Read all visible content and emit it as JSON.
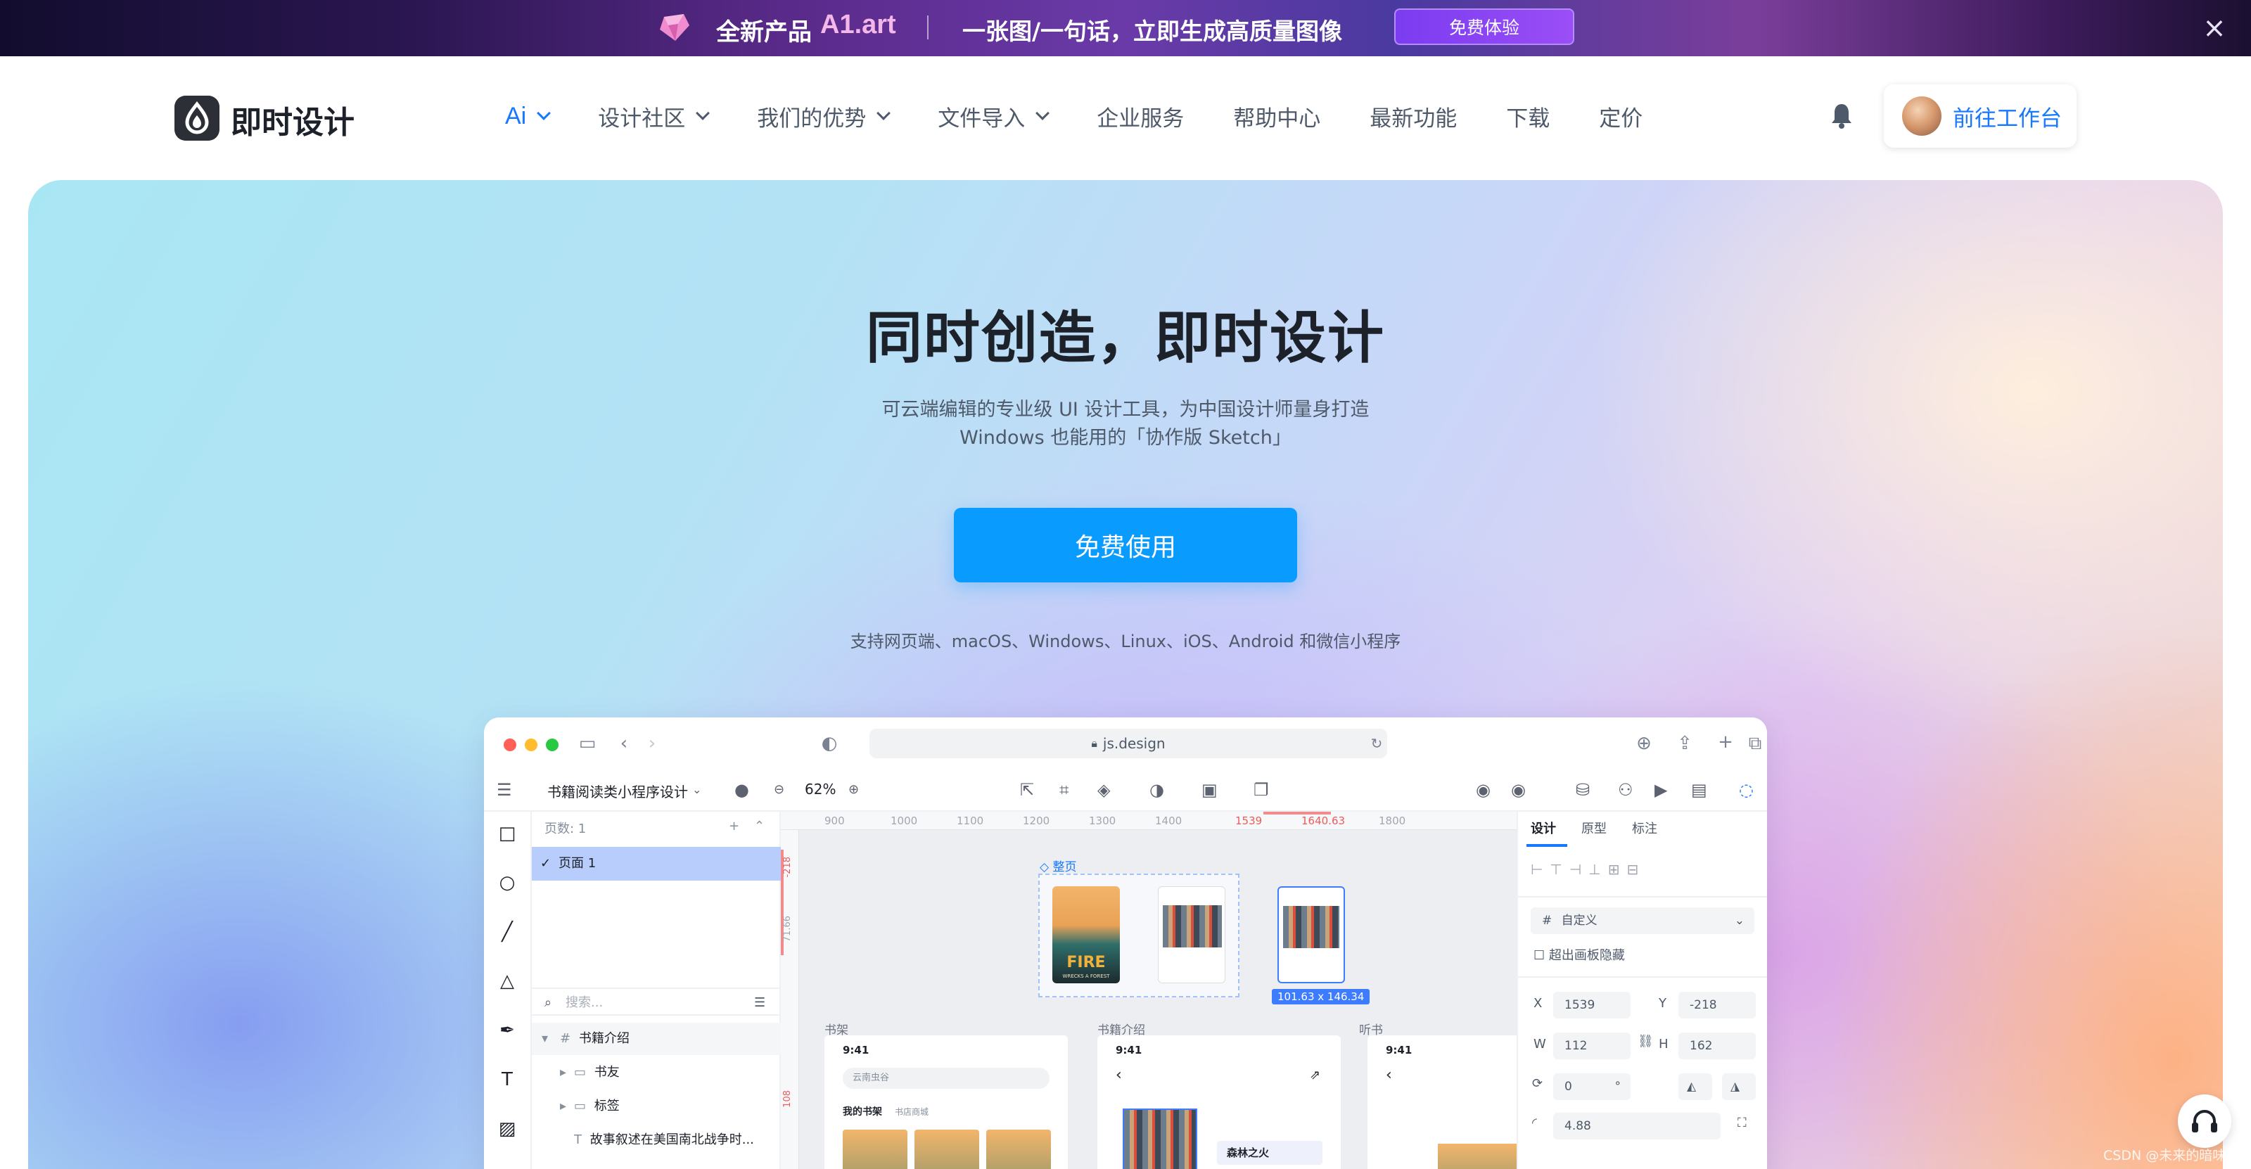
{
  "banner": {
    "title": "全新产品",
    "brand": "A1.art",
    "slogan": "一张图/一句话，立即生成高质量图像",
    "cta": "免费体验"
  },
  "nav": {
    "logo_text": "即时设计",
    "items": [
      {
        "label": "Ai",
        "dropdown": true
      },
      {
        "label": "设计社区",
        "dropdown": true
      },
      {
        "label": "我们的优势",
        "dropdown": true
      },
      {
        "label": "文件导入",
        "dropdown": true
      },
      {
        "label": "企业服务",
        "dropdown": false
      },
      {
        "label": "帮助中心",
        "dropdown": false
      },
      {
        "label": "最新功能",
        "dropdown": false
      },
      {
        "label": "下载",
        "dropdown": false
      },
      {
        "label": "定价",
        "dropdown": false
      }
    ],
    "workbench": "前往工作台"
  },
  "hero": {
    "title": "同时创造，即时设计",
    "subtitle_line1": "可云端编辑的专业级 UI 设计工具，为中国设计师量身打造",
    "subtitle_line2": "Windows 也能用的「协作版 Sketch」",
    "cta": "免费使用",
    "platforms": "支持网页端、macOS、Windows、Linux、iOS、Android 和微信小程序"
  },
  "app": {
    "url": "js.design",
    "file_name": "书籍阅读类小程序设计",
    "zoom": "62%",
    "pages_header": "页数: 1",
    "page_name": "页面 1",
    "search_placeholder": "搜索...",
    "layers": [
      {
        "label": "书籍介绍",
        "level": 0
      },
      {
        "label": "书友",
        "level": 1
      },
      {
        "label": "标签",
        "level": 1
      },
      {
        "label": "故事叙述在美国南北战争时...",
        "level": 1
      }
    ],
    "ruler_ticks": [
      "900",
      "1000",
      "1100",
      "1200",
      "1300",
      "1400",
      "1539",
      "1640.63",
      "1800"
    ],
    "ruler_left": [
      "-218",
      "71.66",
      "108"
    ],
    "frame_label": "整页",
    "selection_size": "101.63 x 146.34",
    "frames": [
      "书架",
      "书籍介绍",
      "听书"
    ],
    "phone_time": "9:41",
    "search_box": "云南虫谷",
    "shelf_tabs": [
      "我的书架",
      "书店商城"
    ],
    "book_title": "森林之火",
    "poster_text": "FIRE",
    "poster_sub": "WRECKS A FOREST",
    "panel": {
      "tabs": [
        "设计",
        "原型",
        "标注"
      ],
      "frame_type": "自定义",
      "clip_label": "超出画板隐藏",
      "x_label": "X",
      "x_value": "1539",
      "y_label": "Y",
      "y_value": "-218",
      "w_label": "W",
      "w_value": "112",
      "h_label": "H",
      "h_value": "162",
      "rotation": "0",
      "rotation_unit": "°",
      "radius": "4.88"
    }
  },
  "watermark": "CSDN @未来的暗味喀",
  "colors": {
    "brand_blue": "#1677ff",
    "cta_blue": "#0a9bff",
    "banner_purple": "#5a2a8a"
  }
}
